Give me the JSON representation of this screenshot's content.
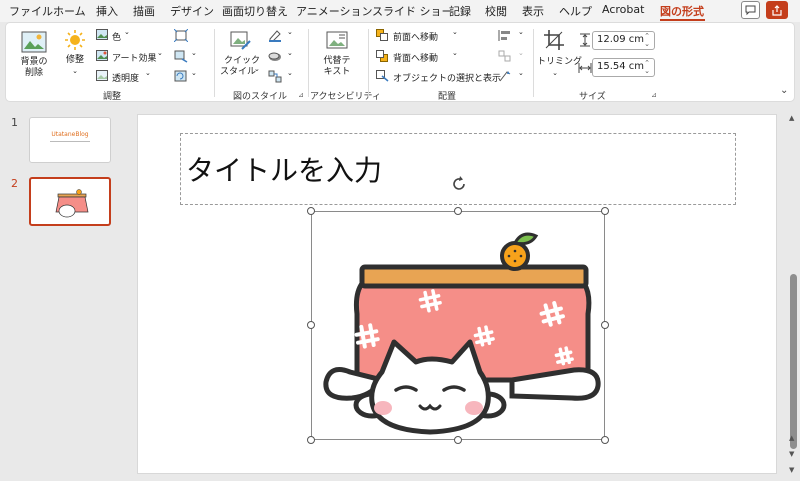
{
  "menu": {
    "tabs": [
      "ファイル",
      "ホーム",
      "挿入",
      "描画",
      "デザイン",
      "画面切り替え",
      "アニメーション",
      "スライド ショー",
      "記録",
      "校閲",
      "表示",
      "ヘルプ",
      "Acrobat",
      "図の形式"
    ],
    "active_tab": "図の形式"
  },
  "ribbon": {
    "groups": {
      "adjust": "調整",
      "picture_styles": "図のスタイル",
      "accessibility": "アクセシビリティ",
      "arrange": "配置",
      "size": "サイズ"
    },
    "remove_bg": [
      "背景の",
      "削除"
    ],
    "corrections": "修整",
    "color": "色",
    "artistic_effects": "アート効果",
    "transparency": "透明度",
    "quick_styles": [
      "クイック",
      "スタイル"
    ],
    "alt_text": [
      "代替テ",
      "キスト"
    ],
    "bring_forward": "前面へ移動",
    "send_backward": "背面へ移動",
    "selection_pane": "オブジェクトの選択と表示",
    "crop": "トリミング",
    "height": "12.09 cm",
    "width": "15.54 cm"
  },
  "thumbnails": [
    {
      "number": "1",
      "title": "UtataneBlog"
    },
    {
      "number": "2",
      "title": ""
    }
  ],
  "slide": {
    "title_placeholder": "タイトルを入力"
  },
  "colors": {
    "accent": "#c43e1c",
    "kotatsu_quilt": "#f58e88",
    "tabletop": "#e8a453",
    "orange": "#f7a21b"
  }
}
